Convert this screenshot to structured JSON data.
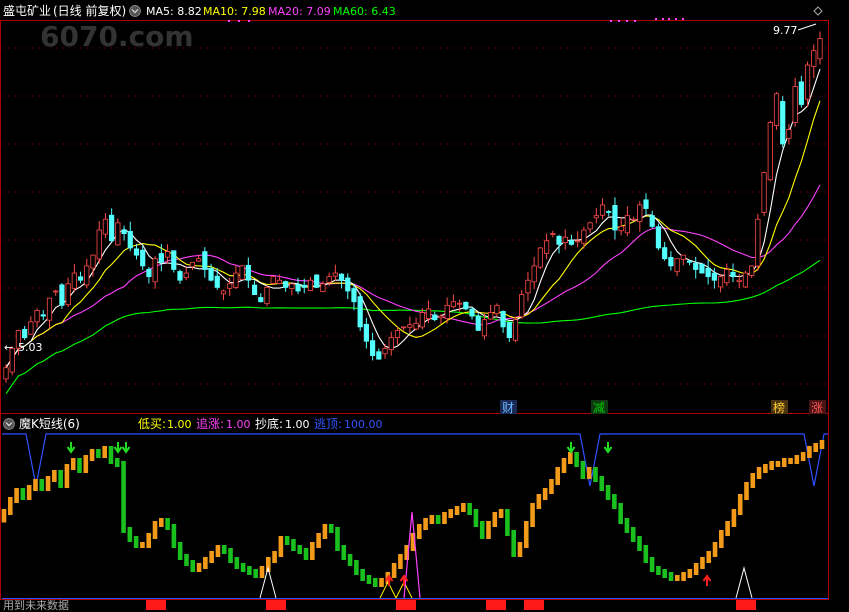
{
  "watermark": "6070.com",
  "header": {
    "stock_name": "盛屯矿业",
    "mode": "(日线 前复权)",
    "ma": [
      {
        "label": "MA5: 8.82",
        "color": "#ffffff"
      },
      {
        "label": "MA10: 7.98",
        "color": "#ffff00"
      },
      {
        "label": "MA20: 7.09",
        "color": "#ff40ff"
      },
      {
        "label": "MA60: 6.43",
        "color": "#00ff00"
      }
    ]
  },
  "main_chart": {
    "price_high_label": "9.77",
    "price_low_label": "5.03",
    "event_tags": [
      {
        "text": "财",
        "color": "#6ab7ff"
      },
      {
        "text": "减",
        "color": "#00cc00"
      },
      {
        "text": "榜",
        "color": "#ffcc33"
      },
      {
        "text": "涨",
        "color": "#ff5555"
      }
    ]
  },
  "indicator": {
    "name": "魔K短线(6)",
    "items": [
      {
        "label": "低买:",
        "value": "1.00",
        "color": "#ffff00"
      },
      {
        "label": "追涨:",
        "value": "1.00",
        "color": "#ff40ff"
      },
      {
        "label": "抄底:",
        "value": "1.00",
        "color": "#ffffff"
      },
      {
        "label": "逃顶:",
        "value": "100.00",
        "color": "#3355ff"
      }
    ]
  },
  "footer": {
    "text": "用到未来数据"
  },
  "colors": {
    "bg": "#000000",
    "frame": "#c00000",
    "up": "#ff4a4a",
    "down": "#54ffff",
    "ind_up": "#f39a1a",
    "ind_down": "#19c01e"
  },
  "chart_data": [
    {
      "type": "candlestick",
      "title": "盛屯矿业 (日线 前复权)",
      "ylim": [
        4.8,
        10.0
      ],
      "annotations": [
        "9.77",
        "5.03"
      ],
      "series": [
        {
          "name": "MA5",
          "last": 8.82
        },
        {
          "name": "MA10",
          "last": 7.98
        },
        {
          "name": "MA20",
          "last": 7.09
        },
        {
          "name": "MA60",
          "last": 6.43
        }
      ],
      "close": [
        5.18,
        5.45,
        5.7,
        5.6,
        5.82,
        5.98,
        5.9,
        6.15,
        6.25,
        6.05,
        6.35,
        6.5,
        6.4,
        6.6,
        6.75,
        7.1,
        7.25,
        6.95,
        7.2,
        7.05,
        6.85,
        6.75,
        6.6,
        6.45,
        6.7,
        6.65,
        6.8,
        6.55,
        6.4,
        6.5,
        6.65,
        6.7,
        6.55,
        6.4,
        6.3,
        6.25,
        6.35,
        6.5,
        6.6,
        6.4,
        6.2,
        6.1,
        6.3,
        6.45,
        6.4,
        6.3,
        6.35,
        6.25,
        6.3,
        6.4,
        6.3,
        6.35,
        6.45,
        6.5,
        6.4,
        6.25,
        6.1,
        5.75,
        5.55,
        5.35,
        5.3,
        5.45,
        5.6,
        5.7,
        5.75,
        5.78,
        5.8,
        5.95,
        6.0,
        5.85,
        5.9,
        6.05,
        6.1,
        6.08,
        6.0,
        5.9,
        5.7,
        5.85,
        5.95,
        6.05,
        5.75,
        5.6,
        5.85,
        6.2,
        6.4,
        6.6,
        6.85,
        6.95,
        7.05,
        6.9,
        7.0,
        6.9,
        6.95,
        7.1,
        7.2,
        7.3,
        7.45,
        7.35,
        7.1,
        7.15,
        7.3,
        7.25,
        7.45,
        7.4,
        7.15,
        6.85,
        6.7,
        6.6,
        6.7,
        6.75,
        6.65,
        6.55,
        6.5,
        6.45,
        6.4,
        6.45,
        6.55,
        6.45,
        6.4,
        6.5,
        6.6,
        7.25,
        7.9,
        8.6,
        9.0,
        8.3,
        8.5,
        9.1,
        8.85,
        9.4,
        9.6,
        9.77
      ],
      "x_count": 131
    },
    {
      "type": "bar",
      "title": "魔K短线(6)",
      "ylim": [
        0,
        100
      ],
      "series": [
        {
          "name": "低买",
          "last": 1.0
        },
        {
          "name": "追涨",
          "last": 1.0
        },
        {
          "name": "抄底",
          "last": 1.0
        },
        {
          "name": "逃顶",
          "last": 100.0
        }
      ],
      "values": [
        52,
        60,
        66,
        62,
        68,
        72,
        68,
        74,
        78,
        70,
        82,
        86,
        80,
        88,
        92,
        90,
        94,
        86,
        84,
        40,
        34,
        30,
        30,
        36,
        44,
        46,
        42,
        30,
        22,
        18,
        14,
        16,
        20,
        24,
        28,
        26,
        20,
        16,
        14,
        12,
        10,
        14,
        20,
        24,
        34,
        32,
        28,
        26,
        22,
        30,
        36,
        42,
        40,
        28,
        22,
        18,
        12,
        8,
        6,
        4,
        6,
        10,
        16,
        22,
        28,
        36,
        42,
        46,
        48,
        46,
        50,
        52,
        54,
        56,
        52,
        44,
        36,
        44,
        50,
        52,
        38,
        24,
        30,
        44,
        56,
        62,
        66,
        72,
        80,
        86,
        90,
        84,
        76,
        80,
        74,
        68,
        62,
        56,
        46,
        40,
        34,
        28,
        20,
        14,
        12,
        10,
        8,
        8,
        10,
        12,
        16,
        20,
        24,
        30,
        38,
        44,
        52,
        62,
        70,
        76,
        80,
        82,
        84,
        84,
        86,
        86,
        88,
        90,
        94,
        96,
        98
      ]
    }
  ]
}
